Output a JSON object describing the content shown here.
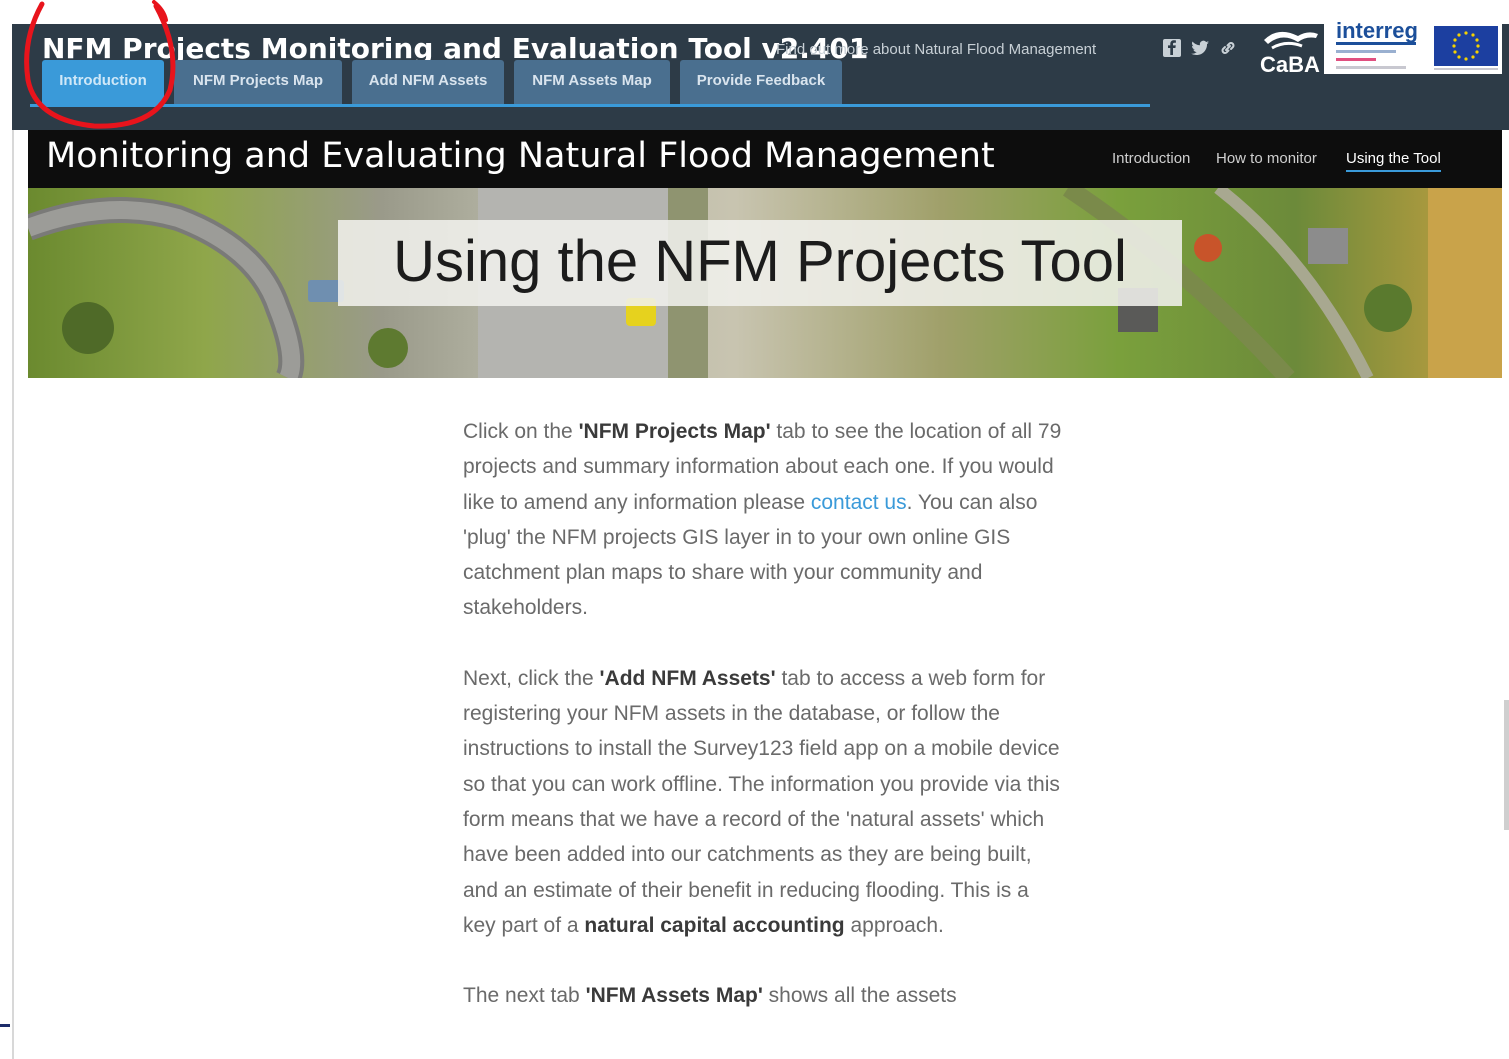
{
  "header": {
    "title": "NFM Projects Monitoring and Evaluation Tool v2.401",
    "find_more": "Find out more about Natural Flood Management",
    "caba_logo_text": "CaBA",
    "interreg_logo_text": "interreg"
  },
  "tabs": [
    {
      "label": "Introduction",
      "active": true
    },
    {
      "label": "NFM Projects Map",
      "active": false
    },
    {
      "label": "Add NFM Assets",
      "active": false
    },
    {
      "label": "NFM Assets Map",
      "active": false
    },
    {
      "label": "Provide Feedback",
      "active": false
    }
  ],
  "subheader": {
    "title": "Monitoring and Evaluating Natural Flood Management",
    "nav": [
      "Introduction",
      "How to monitor",
      "Using the Tool"
    ],
    "current": "Using the Tool"
  },
  "banner": {
    "title": "Using the NFM Projects Tool"
  },
  "content": {
    "p1_a": "Click on the ",
    "p1_b": "'NFM Projects Map'",
    "p1_c": " tab to see the location of all 79 projects and summary information about each one. If  you would like to amend any information please ",
    "p1_link": "contact us",
    "p1_d": ".  You can also 'plug' the NFM projects GIS layer in to your own online GIS catchment plan maps to share with your community and stakeholders.",
    "p2_a": "Next, click the ",
    "p2_b": "'Add NFM Assets'",
    "p2_c": " tab to access a web form for registering your NFM assets in the database, or follow the instructions to install the Survey123 field app on a mobile device so that you can work offline. The information you provide via this form means that we have a record of the 'natural assets' which have been added into our catchments as they are being built, and an estimate of their benefit in reducing flooding. This is a key part of a ",
    "p2_d": "natural capital accounting",
    "p2_e": " approach.",
    "p3_a": "The next tab ",
    "p3_b": "'NFM Assets Map'",
    "p3_c": " shows all the assets"
  },
  "colors": {
    "topbar": "#2d3b47",
    "tab": "#4a6f8f",
    "tab_active": "#3a9ad9",
    "subheader": "#0d0d0d",
    "link": "#3a9ad9",
    "annotation_circle": "#e8141c"
  }
}
